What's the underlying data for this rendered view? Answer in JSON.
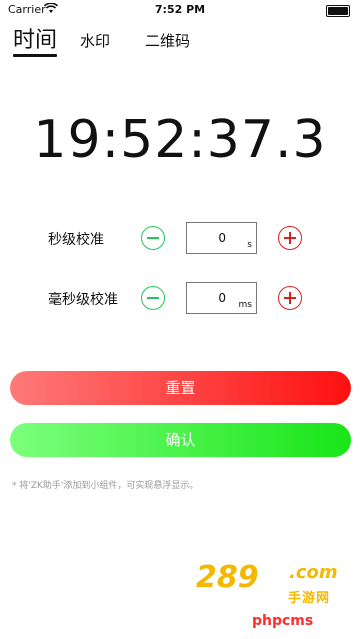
{
  "status": {
    "carrier": "Carrier",
    "time": "7:52 PM"
  },
  "tabs": [
    {
      "label": "时间",
      "active": true
    },
    {
      "label": "水印",
      "active": false
    },
    {
      "label": "二维码",
      "active": false
    }
  ],
  "clock": {
    "display": "19:52:37.3"
  },
  "calibration": {
    "seconds": {
      "label": "秒级校准",
      "value": "0",
      "unit": "s"
    },
    "milliseconds": {
      "label": "毫秒级校准",
      "value": "0",
      "unit": "ms"
    }
  },
  "buttons": {
    "reset": "重置",
    "confirm": "确认"
  },
  "tip": "* 将'ZK助手'添加到小组件，可实现悬浮显示。",
  "watermark": {
    "number": "289",
    "com": ".com",
    "cn": "手游网",
    "brand": "phpcms"
  },
  "colors": {
    "accent_red": "#ff1010",
    "accent_green": "#18e518",
    "minus_green": "#22c55e",
    "plus_red": "#d92020"
  },
  "icons": [
    "wifi-icon",
    "battery-icon",
    "minus-icon",
    "plus-icon"
  ]
}
